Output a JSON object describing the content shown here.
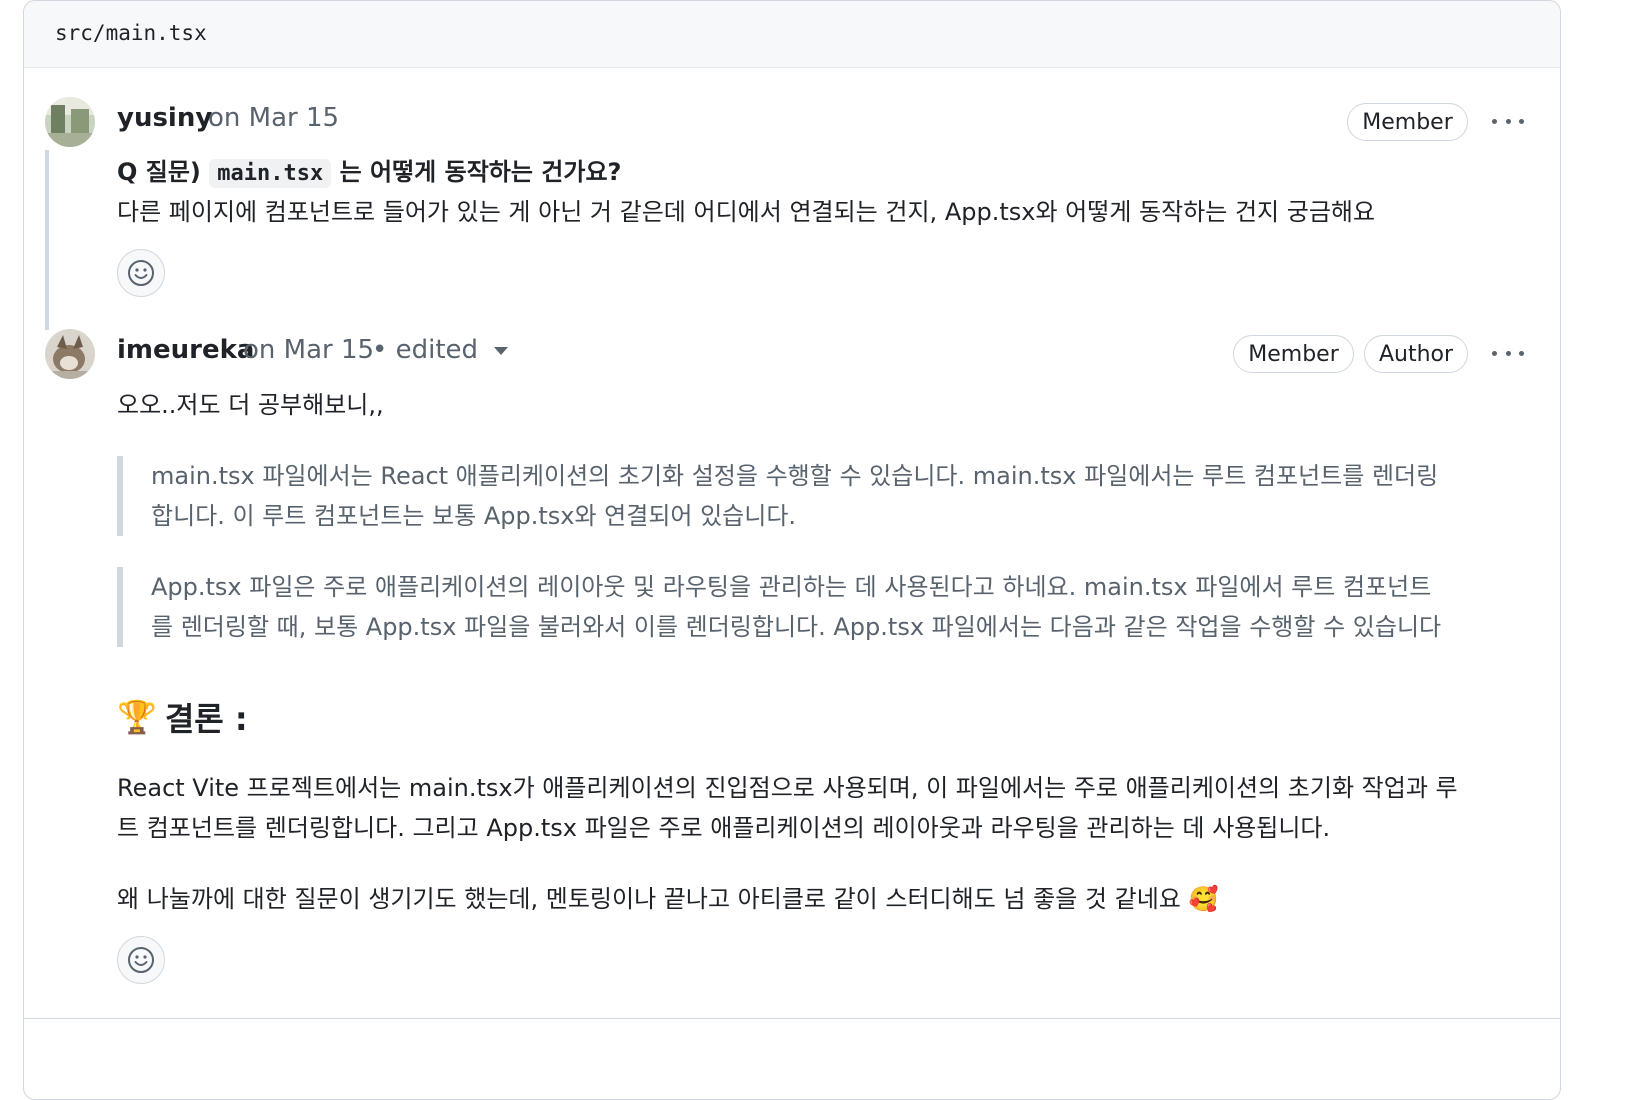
{
  "file": {
    "path": "src/main.tsx"
  },
  "comments": [
    {
      "author": "yusiny",
      "date": "on Mar 15",
      "badges": [
        "Member"
      ],
      "question_prefix": "Q 질문)",
      "question_code": "main.tsx",
      "question_suffix": "는 어떻게 동작하는 건가요?",
      "body": "다른 페이지에 컴포넌트로 들어가 있는 게 아닌 거 같은데 어디에서 연결되는 건지, App.tsx와 어떻게 동작하는 건지 궁금해요"
    },
    {
      "author": "imeureka",
      "date": "on Mar 15",
      "edited": "• edited",
      "badges": [
        "Member",
        "Author"
      ],
      "intro": "오오..저도 더 공부해보니,,",
      "quote1": [
        "main.tsx 파일에서는 React 애플리케이션의 초기화 설정을 수행할 수 있습니다. main.tsx 파일에서는 루트 컴포넌트를 렌더링",
        "합니다. 이 루트 컴포넌트는 보통 App.tsx와 연결되어 있습니다."
      ],
      "quote2": [
        "App.tsx 파일은 주로 애플리케이션의 레이아웃 및 라우팅을 관리하는 데 사용된다고 하네요. main.tsx 파일에서 루트 컴포넌트",
        "를 렌더링할 때, 보통 App.tsx 파일을 불러와서 이를 렌더링합니다. App.tsx 파일에서는 다음과 같은 작업을 수행할 수 있습니다"
      ],
      "heading_emoji": "🏆",
      "heading": "결론 :",
      "conclusion": [
        "React Vite 프로젝트에서는 main.tsx가 애플리케이션의 진입점으로 사용되며, 이 파일에서는 주로 애플리케이션의 초기화 작업과 루",
        "트 컴포넌트를 렌더링합니다. 그리고 App.tsx 파일은 주로 애플리케이션의 레이아웃과 라우팅을 관리하는 데 사용됩니다."
      ],
      "closing": "왜 나눌까에 대한 질문이 생기기도 했는데, 멘토링이나 끝나고 아티클로 같이 스터디해도 넘 좋을 것 같네요",
      "closing_emoji": "🥰"
    }
  ],
  "icons": {
    "more": "kebab-horizontal-icon",
    "reaction": "smiley-icon",
    "avatar1": "avatar-yusiny",
    "avatar2": "avatar-imeureka"
  }
}
